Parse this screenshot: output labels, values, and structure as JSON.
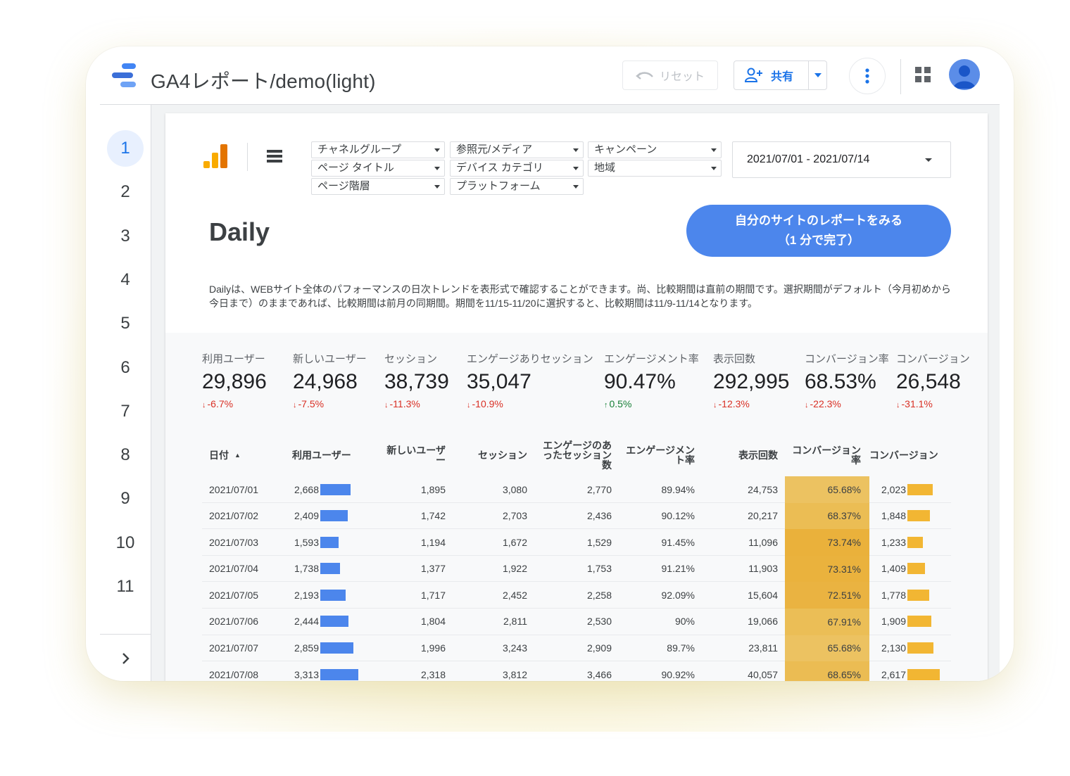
{
  "header": {
    "title": "GA4レポート/demo(light)",
    "reset_label": "リセット",
    "share_label": "共有"
  },
  "pages": [
    "1",
    "2",
    "3",
    "4",
    "5",
    "6",
    "7",
    "8",
    "9",
    "10",
    "11"
  ],
  "filters": {
    "row1": [
      "チャネルグループ",
      "参照元/メディア",
      "キャンペーン"
    ],
    "row2": [
      "ページ タイトル",
      "デバイス カテゴリ",
      "地域"
    ],
    "row3": [
      "ページ階層",
      "プラットフォーム"
    ]
  },
  "date_range": "2021/07/01 - 2021/07/14",
  "report": {
    "title": "Daily",
    "cta_line1": "自分のサイトのレポートをみる",
    "cta_line2": "（1 分で完了）",
    "description": "Dailyは、WEBサイト全体のパフォーマンスの日次トレンドを表形式で確認することができます。尚、比較期間は直前の期間です。選択期間がデフォルト（今月初めから今日まで）のままであれば、比較期間は前月の同期間。期間を11/15-11/20に選択すると、比較期間は11/9-11/14となります。"
  },
  "kpis": [
    {
      "label": "利用ユーザー",
      "value": "29,896",
      "delta": "-6.7%",
      "dir": "down"
    },
    {
      "label": "新しいユーザー",
      "value": "24,968",
      "delta": "-7.5%",
      "dir": "down"
    },
    {
      "label": "セッション",
      "value": "38,739",
      "delta": "-11.3%",
      "dir": "down"
    },
    {
      "label": "エンゲージありセッション",
      "value": "35,047",
      "delta": "-10.9%",
      "dir": "down"
    },
    {
      "label": "エンゲージメント率",
      "value": "90.47%",
      "delta": "0.5%",
      "dir": "up"
    },
    {
      "label": "表示回数",
      "value": "292,995",
      "delta": "-12.3%",
      "dir": "down"
    },
    {
      "label": "コンバージョン率",
      "value": "68.53%",
      "delta": "-22.3%",
      "dir": "down"
    },
    {
      "label": "コンバージョン",
      "value": "26,548",
      "delta": "-31.1%",
      "dir": "down"
    }
  ],
  "table": {
    "headers": [
      "日付",
      "利用ユーザー",
      "新しいユーザー",
      "セッション",
      "エンゲージのあったセッション数",
      "エンゲージメント率",
      "表示回数",
      "コンバージョン率",
      "コンバージョン"
    ],
    "sort_indicator": "▲",
    "rows": [
      {
        "date": "2021/07/01",
        "users": "2,668",
        "new_users": "1,895",
        "sessions": "3,080",
        "engaged": "2,770",
        "eng_rate": "89.94%",
        "views": "24,753",
        "conv_rate": "65.68%",
        "conversions": "2,023",
        "users_num": 2668,
        "conv_rate_num": 65.68,
        "conv_num": 2023
      },
      {
        "date": "2021/07/02",
        "users": "2,409",
        "new_users": "1,742",
        "sessions": "2,703",
        "engaged": "2,436",
        "eng_rate": "90.12%",
        "views": "20,217",
        "conv_rate": "68.37%",
        "conversions": "1,848",
        "users_num": 2409,
        "conv_rate_num": 68.37,
        "conv_num": 1848
      },
      {
        "date": "2021/07/03",
        "users": "1,593",
        "new_users": "1,194",
        "sessions": "1,672",
        "engaged": "1,529",
        "eng_rate": "91.45%",
        "views": "11,096",
        "conv_rate": "73.74%",
        "conversions": "1,233",
        "users_num": 1593,
        "conv_rate_num": 73.74,
        "conv_num": 1233
      },
      {
        "date": "2021/07/04",
        "users": "1,738",
        "new_users": "1,377",
        "sessions": "1,922",
        "engaged": "1,753",
        "eng_rate": "91.21%",
        "views": "11,903",
        "conv_rate": "73.31%",
        "conversions": "1,409",
        "users_num": 1738,
        "conv_rate_num": 73.31,
        "conv_num": 1409
      },
      {
        "date": "2021/07/05",
        "users": "2,193",
        "new_users": "1,717",
        "sessions": "2,452",
        "engaged": "2,258",
        "eng_rate": "92.09%",
        "views": "15,604",
        "conv_rate": "72.51%",
        "conversions": "1,778",
        "users_num": 2193,
        "conv_rate_num": 72.51,
        "conv_num": 1778
      },
      {
        "date": "2021/07/06",
        "users": "2,444",
        "new_users": "1,804",
        "sessions": "2,811",
        "engaged": "2,530",
        "eng_rate": "90%",
        "views": "19,066",
        "conv_rate": "67.91%",
        "conversions": "1,909",
        "users_num": 2444,
        "conv_rate_num": 67.91,
        "conv_num": 1909
      },
      {
        "date": "2021/07/07",
        "users": "2,859",
        "new_users": "1,996",
        "sessions": "3,243",
        "engaged": "2,909",
        "eng_rate": "89.7%",
        "views": "23,811",
        "conv_rate": "65.68%",
        "conversions": "2,130",
        "users_num": 2859,
        "conv_rate_num": 65.68,
        "conv_num": 2130
      },
      {
        "date": "2021/07/08",
        "users": "3,313",
        "new_users": "2,318",
        "sessions": "3,812",
        "engaged": "3,466",
        "eng_rate": "90.92%",
        "views": "40,057",
        "conv_rate": "68.65%",
        "conversions": "2,617",
        "users_num": 3313,
        "conv_rate_num": 68.65,
        "conv_num": 2617
      }
    ]
  },
  "colors": {
    "accent_blue": "#4c86ec",
    "bar_yellow": "#f2b633",
    "delta_down": "#d93025",
    "delta_up": "#188038"
  }
}
